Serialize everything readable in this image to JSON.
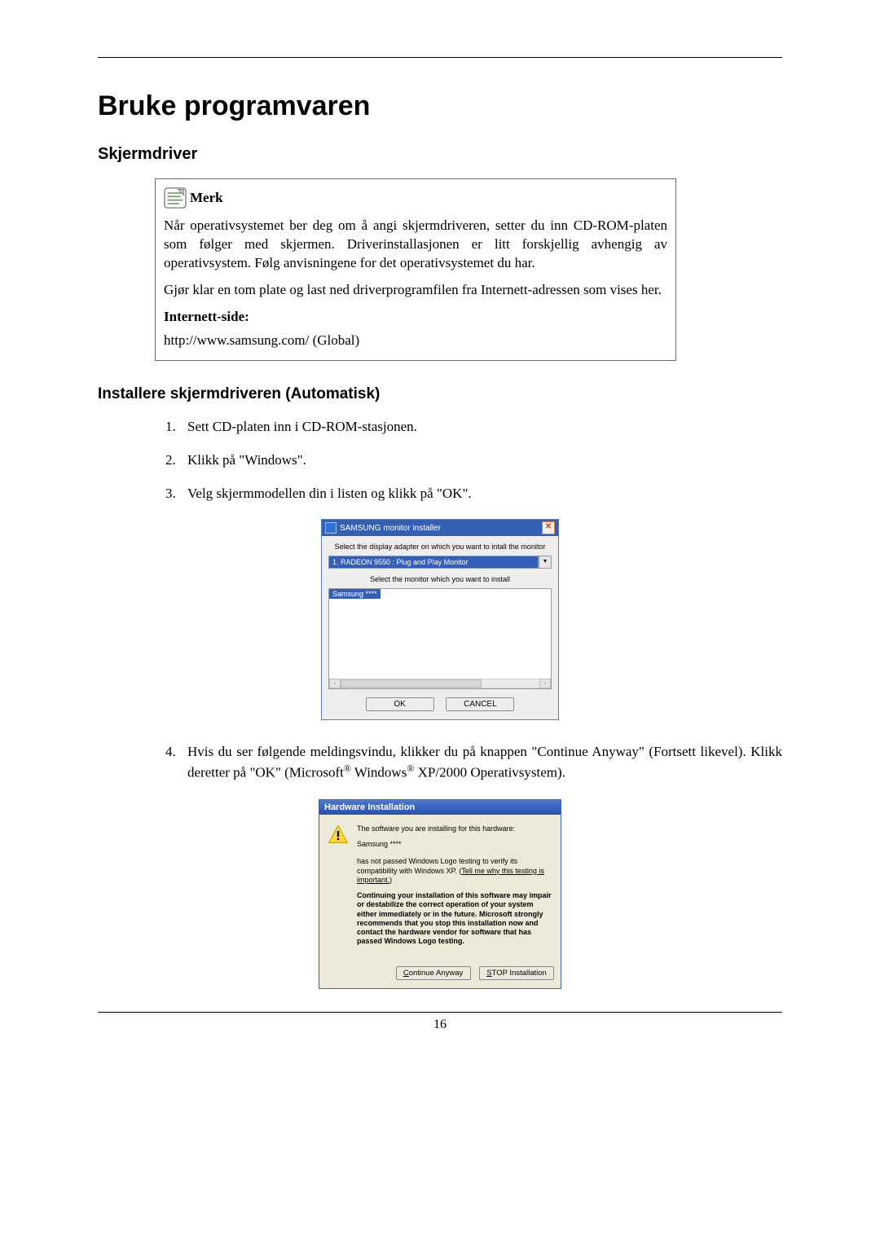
{
  "title": "Bruke programvaren",
  "section1": "Skjermdriver",
  "note": {
    "label": "Merk",
    "p1": "Når operativsystemet ber deg om å angi skjermdriveren, setter du inn CD-ROM-platen som følger med skjermen. Driverinstallasjonen er litt forskjellig avhengig av operativsystem. Følg anvisningene for det operativsystemet du har.",
    "p2": "Gjør klar en tom plate og last ned driverprogramfilen fra Internett-adressen som vises her.",
    "label2": "Internett-side:",
    "url": "http://www.samsung.com/ (Global)"
  },
  "section2": "Installere skjermdriveren (Automatisk)",
  "steps": {
    "s1": "Sett CD-platen inn i CD-ROM-stasjonen.",
    "s2": "Klikk på \"Windows\".",
    "s3": "Velg skjermmodellen din i listen og klikk på \"OK\".",
    "s4a": "Hvis du ser følgende meldingsvindu, klikker du på knappen \"Continue Anyway\" (Fortsett likevel). Klikk deretter på \"OK\" (Microsoft",
    "s4b": " Windows",
    "s4c": " XP/2000 Operativsystem)."
  },
  "installer": {
    "title": "SAMSUNG monitor installer",
    "close": "✕",
    "instr1": "Select the display adapter on which you want to intall the monitor",
    "selected_adapter": "1. RADEON 9550 : Plug and Play Monitor",
    "dropdown_arrow": "▾",
    "instr2": "Select the monitor which you want to install",
    "list_item": "Samsung ****",
    "scroll_left": "‹",
    "scroll_right": "›",
    "ok": "OK",
    "cancel": "CANCEL"
  },
  "hw": {
    "title": "Hardware Installation",
    "line1": "The software you are installing for this hardware:",
    "dev": "Samsung ****",
    "line2a": "has not passed Windows Logo testing to verify its compatibility with Windows XP. (",
    "link": "Tell me why this testing is important.",
    "line2b": ")",
    "bold": "Continuing your installation of this software may impair or destabilize the correct operation of your system either immediately or in the future. Microsoft strongly recommends that you stop this installation now and contact the hardware vendor for software that has passed Windows Logo testing.",
    "btn_continue": "Continue Anyway",
    "btn_stop": "STOP Installation",
    "btn_continue_u": "C",
    "btn_stop_u": "S"
  },
  "page_number": "16",
  "reg": "®"
}
